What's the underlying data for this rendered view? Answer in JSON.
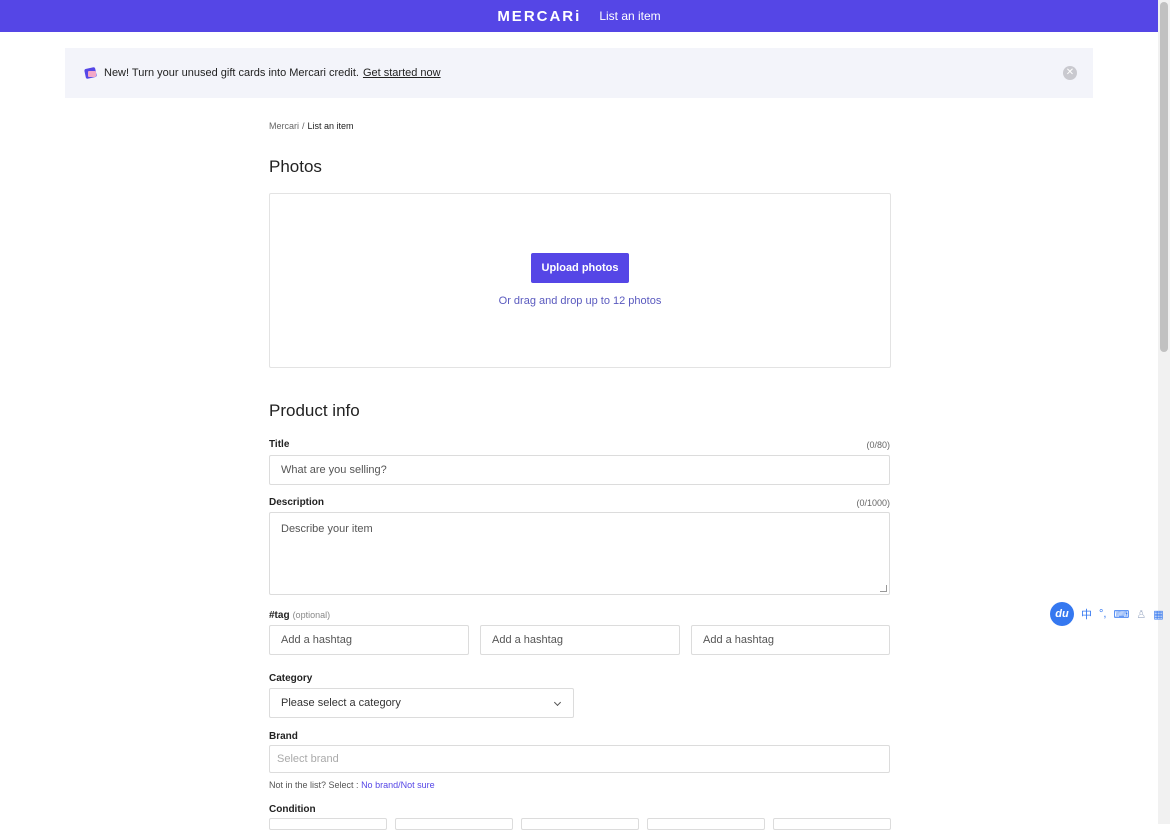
{
  "header": {
    "logo": "MERCARi",
    "title": "List an item"
  },
  "banner": {
    "text": "New! Turn your unused gift cards into Mercari credit.",
    "link": "Get started now"
  },
  "breadcrumb": {
    "root": "Mercari",
    "separator": "/",
    "current": "List an item"
  },
  "photos": {
    "heading": "Photos",
    "upload_label": "Upload photos",
    "hint": "Or drag and drop up to 12 photos"
  },
  "product_info": {
    "heading": "Product info",
    "title_label": "Title",
    "title_counter": "(0/80)",
    "title_placeholder": "What are you selling?",
    "description_label": "Description",
    "description_counter": "(0/1000)",
    "description_placeholder": "Describe your item",
    "tag_label": "#tag",
    "tag_optional": "(optional)",
    "hashtag_placeholder": "Add a hashtag",
    "category_label": "Category",
    "category_value": "Please select a category",
    "brand_label": "Brand",
    "brand_placeholder": "Select brand",
    "brand_note": "Not in the list? Select :",
    "brand_note_link": "No brand/Not sure",
    "condition_label": "Condition"
  },
  "ime_toolbar": {
    "logo": "du",
    "lang": "中",
    "punct": "°,",
    "keyboard": "⌨",
    "user": "♙",
    "grid": "▦"
  },
  "colors": {
    "brand": "#5546e6",
    "banner_bg": "#f3f4fa"
  }
}
